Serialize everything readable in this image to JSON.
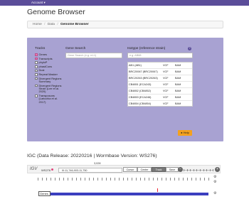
{
  "header": {
    "account_label": "Account ▾",
    "page_title": "Genome Browser"
  },
  "breadcrumb": {
    "home": "Home",
    "data": "Data",
    "current": "Genome Browser",
    "separator": "/"
  },
  "panel": {
    "tracks_label": "Tracks",
    "gene_search_label": "Gene Search",
    "gene_search_placeholder": "Gene Search (e.g. rrt-1)",
    "isotype_label": "Isotype (reference strain)",
    "isotype_placeholder": "e.g. AB88",
    "help_label": "Help",
    "tracks": [
      {
        "label": "Genes",
        "checked": true
      },
      {
        "label": "Transcripts",
        "checked": true
      },
      {
        "label": "phyloP",
        "checked": false
      },
      {
        "label": "phastCons",
        "checked": false
      },
      {
        "label": "Dust",
        "checked": false
      },
      {
        "label": "Repeat Masker",
        "checked": false
      },
      {
        "label": "Divergent Regions Summary",
        "checked": false
      },
      {
        "label": "Divergent Regions Strain (Lee et al. 2020)",
        "checked": false
      },
      {
        "label": "Transposons (Laricchia et al. 2017)",
        "checked": false
      }
    ],
    "isotypes": [
      {
        "name": "AB1 (AB1)",
        "vcf": "VCF",
        "bam": "BAM"
      },
      {
        "name": "BRC20067 (BRC20067)",
        "vcf": "VCF",
        "bam": "BAM"
      },
      {
        "name": "BRC20263 (BRC20263)",
        "vcf": "VCF",
        "bam": "BAM"
      },
      {
        "name": "CB4851 (ECA243)",
        "vcf": "VCF",
        "bam": "BAM"
      },
      {
        "name": "CB4852 (CB4852)",
        "vcf": "VCF",
        "bam": "BAM"
      },
      {
        "name": "CB4853 (ECA246)",
        "vcf": "VCF",
        "bam": "BAM"
      },
      {
        "name": "CB4854 (CB4854)",
        "vcf": "VCF",
        "bam": "BAM"
      }
    ]
  },
  "igc": {
    "heading": "IGC (Data Release: 20220216 | Wormbase Version: WS276)"
  },
  "igv": {
    "logo": "IGV",
    "genome": "WS276",
    "locus": "III:11,746,903-11,750",
    "scale": "3,028",
    "buttons": {
      "cursor": "Cursor",
      "center": "Center",
      "track": "Track",
      "save": "Save"
    },
    "genes_label": "Genes"
  },
  "colors": {
    "topbar": "#5b4d99",
    "panel": "#a8a2d2",
    "help": "#f4a11d",
    "gene_bar": "#3b3fbf",
    "checked": "#e97fb0"
  }
}
